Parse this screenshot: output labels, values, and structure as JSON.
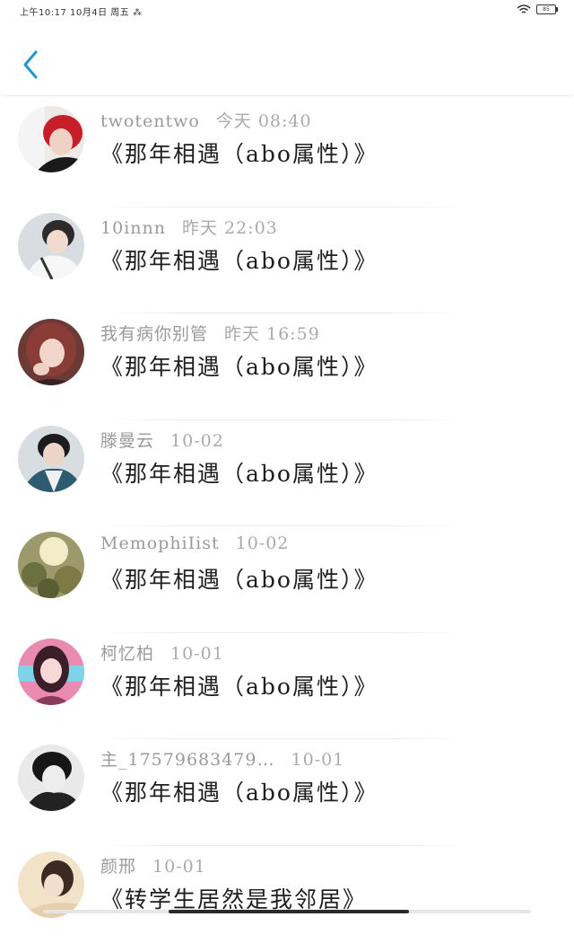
{
  "status_bar": {
    "left_text": "上午10:17  10月4日 周五  ⁂",
    "battery_level": "85"
  },
  "header": {
    "back_icon": "chevron-left-icon",
    "accent_color": "#2196d3"
  },
  "rows": [
    {
      "user": "twotentwo",
      "time": "今天 08:40",
      "title": "《那年相遇（abo属性）》"
    },
    {
      "user": "10innn",
      "time": "昨天 22:03",
      "title": "《那年相遇（abo属性）》"
    },
    {
      "user": "我有病你别管",
      "time": "昨天 16:59",
      "title": "《那年相遇（abo属性）》"
    },
    {
      "user": "滕曼云",
      "time": "10-02",
      "title": "《那年相遇（abo属性）》"
    },
    {
      "user": "MemophiIist",
      "time": "10-02",
      "title": "《那年相遇（abo属性）》"
    },
    {
      "user": "柯忆柏",
      "time": "10-01",
      "title": "《那年相遇（abo属性）》"
    },
    {
      "user": "主_17579683479…",
      "time": "10-01",
      "title": "《那年相遇（abo属性）》"
    },
    {
      "user": "颜邢",
      "time": "10-01",
      "title": "《转学生居然是我邻居》"
    }
  ]
}
